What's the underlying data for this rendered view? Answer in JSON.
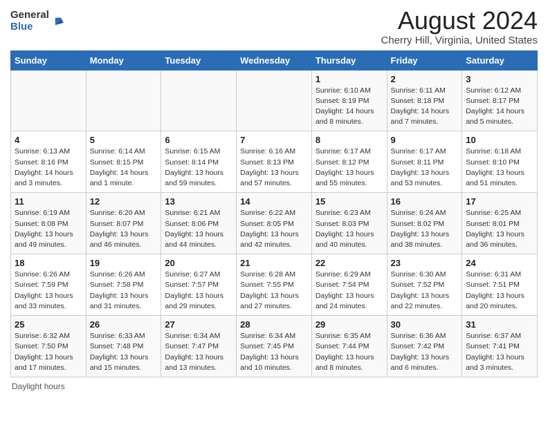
{
  "header": {
    "logo_general": "General",
    "logo_blue": "Blue",
    "title": "August 2024",
    "subtitle": "Cherry Hill, Virginia, United States"
  },
  "days_of_week": [
    "Sunday",
    "Monday",
    "Tuesday",
    "Wednesday",
    "Thursday",
    "Friday",
    "Saturday"
  ],
  "weeks": [
    [
      {
        "day": "",
        "info": ""
      },
      {
        "day": "",
        "info": ""
      },
      {
        "day": "",
        "info": ""
      },
      {
        "day": "",
        "info": ""
      },
      {
        "day": "1",
        "info": "Sunrise: 6:10 AM\nSunset: 8:19 PM\nDaylight: 14 hours\nand 8 minutes."
      },
      {
        "day": "2",
        "info": "Sunrise: 6:11 AM\nSunset: 8:18 PM\nDaylight: 14 hours\nand 7 minutes."
      },
      {
        "day": "3",
        "info": "Sunrise: 6:12 AM\nSunset: 8:17 PM\nDaylight: 14 hours\nand 5 minutes."
      }
    ],
    [
      {
        "day": "4",
        "info": "Sunrise: 6:13 AM\nSunset: 8:16 PM\nDaylight: 14 hours\nand 3 minutes."
      },
      {
        "day": "5",
        "info": "Sunrise: 6:14 AM\nSunset: 8:15 PM\nDaylight: 14 hours\nand 1 minute."
      },
      {
        "day": "6",
        "info": "Sunrise: 6:15 AM\nSunset: 8:14 PM\nDaylight: 13 hours\nand 59 minutes."
      },
      {
        "day": "7",
        "info": "Sunrise: 6:16 AM\nSunset: 8:13 PM\nDaylight: 13 hours\nand 57 minutes."
      },
      {
        "day": "8",
        "info": "Sunrise: 6:17 AM\nSunset: 8:12 PM\nDaylight: 13 hours\nand 55 minutes."
      },
      {
        "day": "9",
        "info": "Sunrise: 6:17 AM\nSunset: 8:11 PM\nDaylight: 13 hours\nand 53 minutes."
      },
      {
        "day": "10",
        "info": "Sunrise: 6:18 AM\nSunset: 8:10 PM\nDaylight: 13 hours\nand 51 minutes."
      }
    ],
    [
      {
        "day": "11",
        "info": "Sunrise: 6:19 AM\nSunset: 8:08 PM\nDaylight: 13 hours\nand 49 minutes."
      },
      {
        "day": "12",
        "info": "Sunrise: 6:20 AM\nSunset: 8:07 PM\nDaylight: 13 hours\nand 46 minutes."
      },
      {
        "day": "13",
        "info": "Sunrise: 6:21 AM\nSunset: 8:06 PM\nDaylight: 13 hours\nand 44 minutes."
      },
      {
        "day": "14",
        "info": "Sunrise: 6:22 AM\nSunset: 8:05 PM\nDaylight: 13 hours\nand 42 minutes."
      },
      {
        "day": "15",
        "info": "Sunrise: 6:23 AM\nSunset: 8:03 PM\nDaylight: 13 hours\nand 40 minutes."
      },
      {
        "day": "16",
        "info": "Sunrise: 6:24 AM\nSunset: 8:02 PM\nDaylight: 13 hours\nand 38 minutes."
      },
      {
        "day": "17",
        "info": "Sunrise: 6:25 AM\nSunset: 8:01 PM\nDaylight: 13 hours\nand 36 minutes."
      }
    ],
    [
      {
        "day": "18",
        "info": "Sunrise: 6:26 AM\nSunset: 7:59 PM\nDaylight: 13 hours\nand 33 minutes."
      },
      {
        "day": "19",
        "info": "Sunrise: 6:26 AM\nSunset: 7:58 PM\nDaylight: 13 hours\nand 31 minutes."
      },
      {
        "day": "20",
        "info": "Sunrise: 6:27 AM\nSunset: 7:57 PM\nDaylight: 13 hours\nand 29 minutes."
      },
      {
        "day": "21",
        "info": "Sunrise: 6:28 AM\nSunset: 7:55 PM\nDaylight: 13 hours\nand 27 minutes."
      },
      {
        "day": "22",
        "info": "Sunrise: 6:29 AM\nSunset: 7:54 PM\nDaylight: 13 hours\nand 24 minutes."
      },
      {
        "day": "23",
        "info": "Sunrise: 6:30 AM\nSunset: 7:52 PM\nDaylight: 13 hours\nand 22 minutes."
      },
      {
        "day": "24",
        "info": "Sunrise: 6:31 AM\nSunset: 7:51 PM\nDaylight: 13 hours\nand 20 minutes."
      }
    ],
    [
      {
        "day": "25",
        "info": "Sunrise: 6:32 AM\nSunset: 7:50 PM\nDaylight: 13 hours\nand 17 minutes."
      },
      {
        "day": "26",
        "info": "Sunrise: 6:33 AM\nSunset: 7:48 PM\nDaylight: 13 hours\nand 15 minutes."
      },
      {
        "day": "27",
        "info": "Sunrise: 6:34 AM\nSunset: 7:47 PM\nDaylight: 13 hours\nand 13 minutes."
      },
      {
        "day": "28",
        "info": "Sunrise: 6:34 AM\nSunset: 7:45 PM\nDaylight: 13 hours\nand 10 minutes."
      },
      {
        "day": "29",
        "info": "Sunrise: 6:35 AM\nSunset: 7:44 PM\nDaylight: 13 hours\nand 8 minutes."
      },
      {
        "day": "30",
        "info": "Sunrise: 6:36 AM\nSunset: 7:42 PM\nDaylight: 13 hours\nand 6 minutes."
      },
      {
        "day": "31",
        "info": "Sunrise: 6:37 AM\nSunset: 7:41 PM\nDaylight: 13 hours\nand 3 minutes."
      }
    ]
  ],
  "footer": {
    "note": "Daylight hours"
  }
}
